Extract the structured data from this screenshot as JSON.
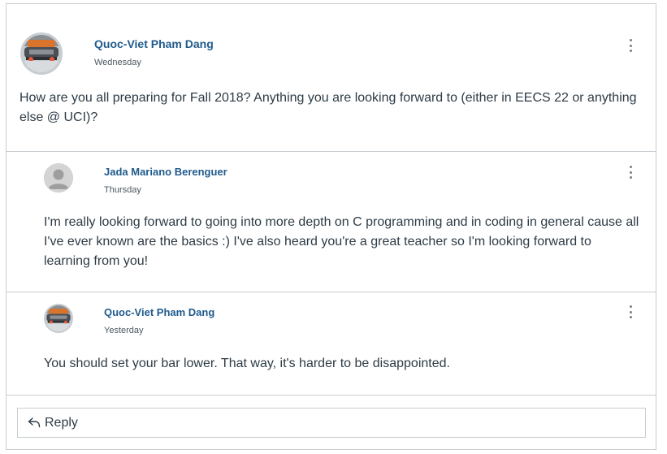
{
  "posts": [
    {
      "author": "Quoc-Viet Pham Dang",
      "date": "Wednesday",
      "avatar": "car-photo-avatar",
      "message": "How are you all preparing for Fall 2018? Anything you are looking forward to (either in EECS 22 or anything else @ UCI)?"
    },
    {
      "author": "Jada Mariano Berenguer",
      "date": "Thursday",
      "avatar": "default-user-avatar",
      "message": "I'm really looking forward to going into more depth on C programming and in coding in general cause all I've ever known are the basics :) I've also heard you're a great teacher so I'm looking forward to learning from you!"
    },
    {
      "author": "Quoc-Viet Pham Dang",
      "date": "Yesterday",
      "avatar": "car-photo-avatar",
      "message": "You should set your bar lower. That way, it's harder to be disappointed."
    }
  ],
  "reply": {
    "label": "Reply",
    "icon": "reply-arrow-icon"
  },
  "colors": {
    "author_link": "#1f5a8c",
    "text": "#2d3b45",
    "border": "#c7cdd1"
  }
}
